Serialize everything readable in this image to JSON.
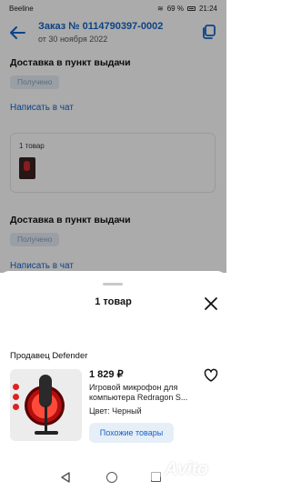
{
  "status_bar": {
    "carrier": "Beeline",
    "battery": "69 %",
    "time": "21:24"
  },
  "header": {
    "title": "Заказ № 0114790397-0002",
    "date": "от 30 ноября 2022"
  },
  "sections": [
    {
      "title": "Доставка в пункт выдачи",
      "status": "Получено",
      "chat": "Написать в чат",
      "goods_count": "1 товар"
    },
    {
      "title": "Доставка в пункт выдачи",
      "status": "Получено",
      "chat": "Написать в чат"
    }
  ],
  "sheet": {
    "title": "1 товар",
    "seller": "Продавец Defender",
    "product": {
      "price": "1 829 ₽",
      "name_line1": "Игровой микрофон для",
      "name_line2": "компьютера Redragon S...",
      "color": "Цвет: Черный",
      "similar_button": "Похожие товары"
    }
  },
  "watermark": "Avito",
  "colors": {
    "accent": "#1464c8",
    "pill_bg": "#e6eef6",
    "button_bg": "#e6eef8"
  }
}
